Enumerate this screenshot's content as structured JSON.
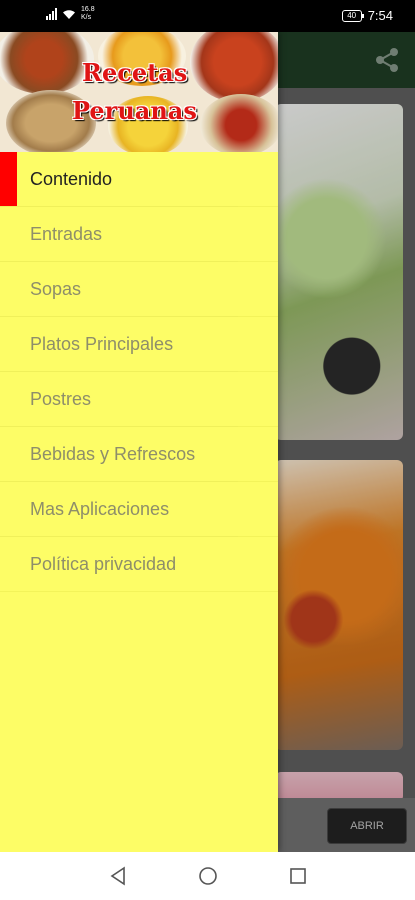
{
  "status_bar": {
    "net_speed": "16.8\nK/s",
    "battery": "40",
    "time": "7:54"
  },
  "header": {
    "logo_line1": "Recetas",
    "logo_line2": "Peruanas"
  },
  "menu": {
    "items": [
      {
        "label": "Contenido",
        "active": true
      },
      {
        "label": "Entradas",
        "active": false
      },
      {
        "label": "Sopas",
        "active": false
      },
      {
        "label": "Platos Principales",
        "active": false
      },
      {
        "label": "Postres",
        "active": false
      },
      {
        "label": "Bebidas y Refrescos",
        "active": false
      },
      {
        "label": "Mas Aplicaciones",
        "active": false
      },
      {
        "label": "Política privacidad",
        "active": false
      }
    ]
  },
  "ad": {
    "button_label": "ABRIR"
  },
  "icons": {
    "share": "share-icon",
    "back": "back-triangle-icon",
    "home": "home-circle-icon",
    "recents": "recents-square-icon"
  },
  "colors": {
    "drawer_bg": "#fdfd66",
    "active_marker": "#ff0000",
    "appbar": "#1d3a23"
  }
}
